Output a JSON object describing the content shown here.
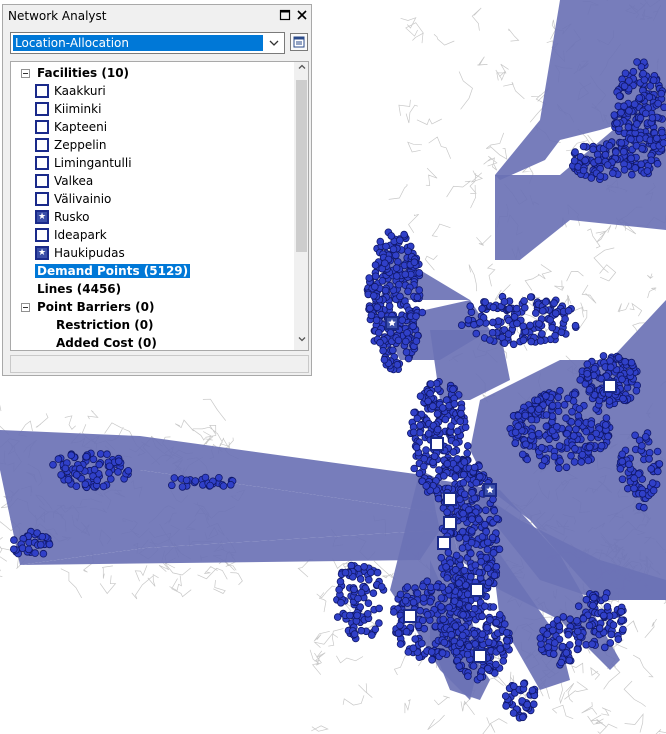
{
  "window": {
    "title": "Network Analyst",
    "maximize_icon": "maximize-icon",
    "close_icon": "close-icon"
  },
  "analysis": {
    "selected": "Location-Allocation",
    "dropdown_icon": "chevron-down-icon",
    "options_icon": "window-icon"
  },
  "tree": {
    "facilities_label": "Facilities (10)",
    "facilities": [
      {
        "name": "Kaakkuri",
        "symbol": "square-icon"
      },
      {
        "name": "Kiiminki",
        "symbol": "square-icon"
      },
      {
        "name": "Kapteeni",
        "symbol": "square-icon"
      },
      {
        "name": "Zeppelin",
        "symbol": "square-icon"
      },
      {
        "name": "Limingantulli",
        "symbol": "square-icon"
      },
      {
        "name": "Valkea",
        "symbol": "square-icon"
      },
      {
        "name": "Välivainio",
        "symbol": "square-icon"
      },
      {
        "name": "Rusko",
        "symbol": "star-square-icon"
      },
      {
        "name": "Ideapark",
        "symbol": "square-icon"
      },
      {
        "name": "Haukipudas",
        "symbol": "star-square-icon"
      }
    ],
    "demand_points": "Demand Points (5129)",
    "lines": "Lines (4456)",
    "point_barriers": "Point Barriers (0)",
    "restriction": "Restriction (0)",
    "added_cost": "Added Cost (0)"
  },
  "colors": {
    "lines": "#6b72b5",
    "demand_fill": "#3040c8",
    "demand_stroke": "#10186a",
    "roads": "#c8c8c8",
    "facility_border": "#1a2a8a"
  }
}
